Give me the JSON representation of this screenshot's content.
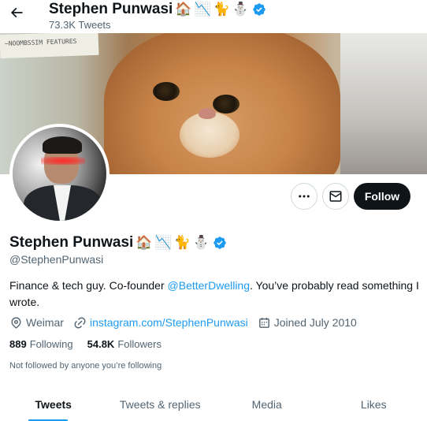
{
  "header": {
    "name": "Stephen Punwasi",
    "tweet_count": "73.3K Tweets",
    "emojis": [
      "🏠",
      "📉",
      "🐈",
      "⛄"
    ]
  },
  "profile": {
    "name": "Stephen Punwasi",
    "handle": "@StephenPunwasi",
    "emojis": [
      "🏠",
      "📉",
      "🐈",
      "⛄"
    ],
    "bio_prefix": "Finance & tech guy. Co-founder ",
    "bio_mention": "@BetterDwelling",
    "bio_suffix": ". You’ve probably read something I wrote.",
    "location": "Weimar",
    "website": "instagram.com/StephenPunwasi",
    "joined": "Joined July 2010",
    "following_count": "889",
    "following_label": "Following",
    "followers_count": "54.8K",
    "followers_label": "Followers",
    "not_followed_by": "Not followed by anyone you’re following"
  },
  "banner": {
    "sign_text": "~NOOMBSSIM FEATURES"
  },
  "actions": {
    "follow_label": "Follow",
    "more_icon": "more-icon",
    "message_icon": "mail-icon"
  },
  "tabs": [
    {
      "label": "Tweets",
      "active": true
    },
    {
      "label": "Tweets & replies",
      "active": false
    },
    {
      "label": "Media",
      "active": false
    },
    {
      "label": "Likes",
      "active": false
    }
  ],
  "colors": {
    "accent": "#1d9bf0",
    "text": "#0f1419",
    "secondary": "#536471",
    "follow_bg": "#0f1419"
  }
}
